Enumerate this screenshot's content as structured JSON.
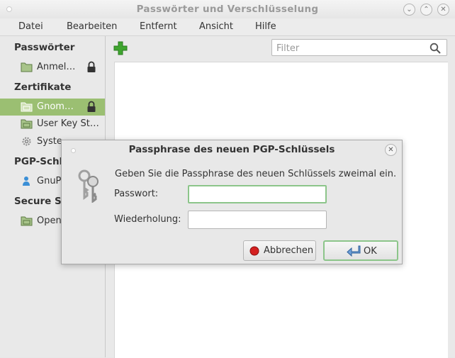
{
  "window": {
    "title": "Passwörter und Verschlüsselung",
    "controls": [
      "minimize",
      "maximize",
      "close"
    ]
  },
  "menu": {
    "items": [
      "Datei",
      "Bearbeiten",
      "Entfernt",
      "Ansicht",
      "Hilfe"
    ]
  },
  "sidebar": {
    "groups": [
      {
        "label": "Passwörter",
        "items": [
          {
            "label": "Anmel…",
            "icon": "folder-icon",
            "locked": true
          }
        ]
      },
      {
        "label": "Zertifikate",
        "items": [
          {
            "label": "Gnom…",
            "icon": "folder-icon",
            "locked": true,
            "selected": true
          },
          {
            "label": "User Key St…",
            "icon": "folder-icon",
            "locked": false
          },
          {
            "label": "Syste…",
            "icon": "gear-icon",
            "locked": false
          }
        ]
      },
      {
        "label": "PGP-Schl…",
        "items": [
          {
            "label": "GnuP…",
            "icon": "person-icon",
            "locked": false
          }
        ]
      },
      {
        "label": "Secure Sh…",
        "items": [
          {
            "label": "Open…",
            "icon": "folder-icon",
            "locked": false
          }
        ]
      }
    ]
  },
  "toolbar": {
    "add_icon": "plus-icon",
    "filter_placeholder": "Filter"
  },
  "dialog": {
    "title": "Passphrase des neuen PGP-Schlüssels",
    "prompt": "Geben Sie die Passphrase des neuen Schlüssels zweimal ein.",
    "password_label": "Passwort:",
    "repeat_label": "Wiederholung:",
    "password_value": "",
    "repeat_value": "",
    "cancel_label": "Abbrechen",
    "ok_label": "OK"
  }
}
